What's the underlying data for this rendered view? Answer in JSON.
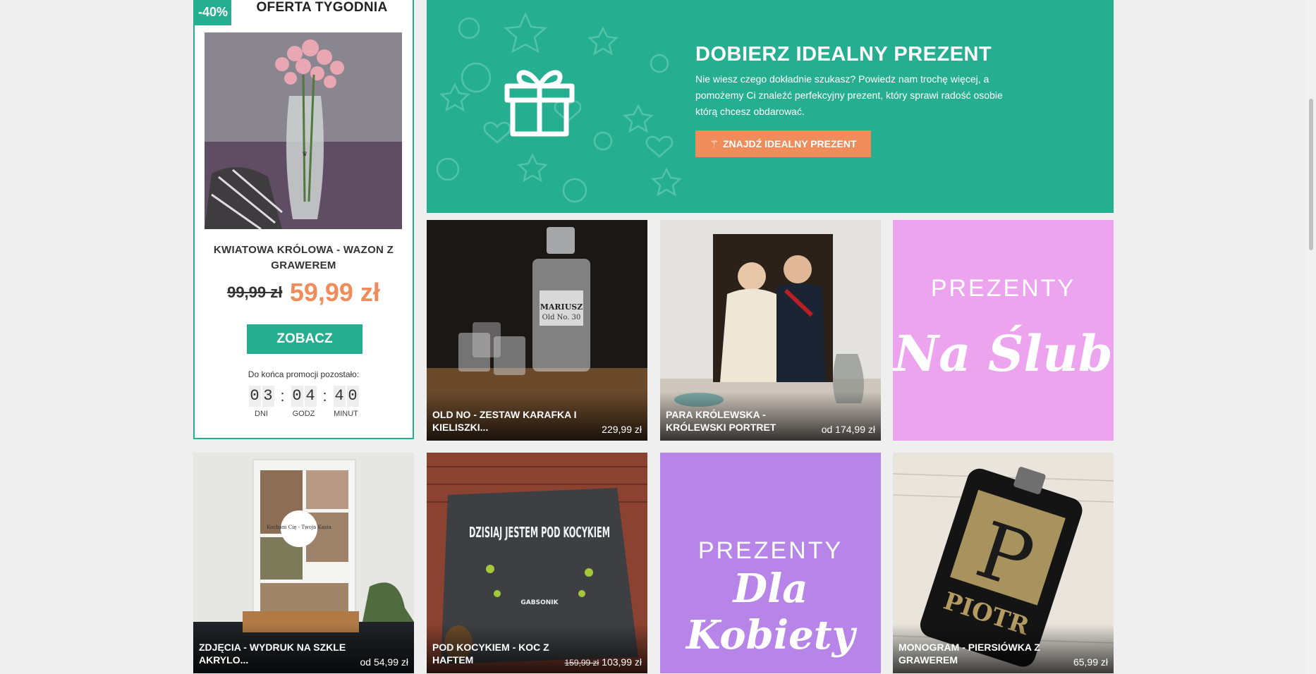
{
  "offer": {
    "badge": "-40%",
    "title": "OFERTA TYGODNIA",
    "product_name": "KWIATOWA KRÓLOWA - WAZON Z GRAWEREM",
    "old_price": "99,99 zł",
    "new_price": "59,99 zł",
    "button_label": "ZOBACZ",
    "countdown_text": "Do końca promocji pozostało:",
    "days": [
      "0",
      "3"
    ],
    "hours": [
      "0",
      "4"
    ],
    "minutes": [
      "4",
      "0"
    ],
    "days_label": "DNI",
    "hours_label": "GODZ",
    "minutes_label": "MINUT",
    "colon": ":"
  },
  "banner": {
    "title": "DOBIERZ IDEALNY PREZENT",
    "text": "Nie wiesz czego dokładnie szukasz? Powiedz nam trochę więcej, a pomożemy Ci znaleźć perfekcyjny prezent, który sprawi radość osobie którą chcesz obdarować.",
    "button_label": "ZNAJDŹ IDEALNY PREZENT",
    "wand_glyph": "⚚"
  },
  "products": [
    {
      "name": "OLD NO - ZESTAW KARAFKA I KIELISZKI...",
      "price": "229,99 zł"
    },
    {
      "name": "PARA KRÓLEWSKA - KRÓLEWSKI PORTRET",
      "price": "od 174,99 zł"
    },
    {
      "name": "ZDJĘCIA - WYDRUK NA SZKLE AKRYLO...",
      "price": "od 54,99 zł"
    },
    {
      "name": "POD KOCYKIEM - KOC Z HAFTEM",
      "old_price": "159,99 zł",
      "price": "103,99 zł"
    },
    {
      "name": "MONOGRAM - PIERSIÓWKA Z GRAWEREM",
      "price": "65,99 zł"
    }
  ],
  "promos": [
    {
      "top": "PREZENTY",
      "big": "Na Ślub",
      "color": "#eda4ef"
    },
    {
      "top": "PREZENTY",
      "big": "Dla Kobiety",
      "color": "#b785e8"
    }
  ],
  "image_text": {
    "decanter_label": "MARIUSZ",
    "decanter_sub": "Old No. 30",
    "blanket_text": "DZISIAJ JESTEM POD KOCYKIEM",
    "blanket_brand": "GABSONIK",
    "flask_letter": "P",
    "flask_name": "PIOTR",
    "photo_caption": "Kocham Cię - Twoja Kasia"
  }
}
